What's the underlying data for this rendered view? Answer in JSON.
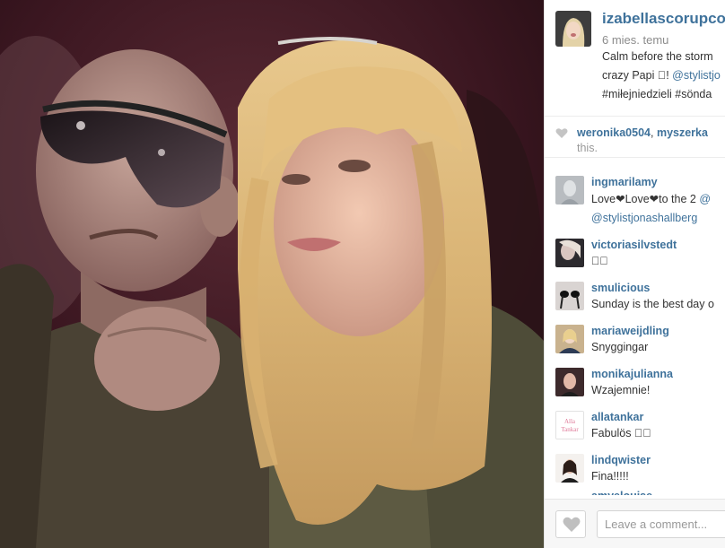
{
  "post": {
    "owner": "izabellascorupco",
    "time": "6 mies. temu",
    "caption_line1": "Calm before the storm",
    "caption_line2_text": "crazy Papi \u0000! ",
    "caption_line2_link": "@stylistjo",
    "caption_line3": "#miłejniedzieli #sönda"
  },
  "likes": {
    "user1": "weronika0504",
    "separator": ", ",
    "user2": "myszerka",
    "suffix": "this."
  },
  "comments": [
    {
      "user": "ingmarilamy",
      "text": "Love❤Love❤to the 2 ",
      "mention": "@",
      "text2": "@stylistjonashallberg"
    },
    {
      "user": "victoriasilvstedt",
      "text": "\u0000\u0000"
    },
    {
      "user": "smulicious",
      "text": "Sunday is the best day o"
    },
    {
      "user": "mariaweijdling",
      "text": "Snyggingar"
    },
    {
      "user": "monikajulianna",
      "text": "Wzajemnie!"
    },
    {
      "user": "allatankar",
      "text": "Fabulös \u0000\u0000",
      "avatar_text_1": "Alla",
      "avatar_text_2": "Tankar"
    },
    {
      "user": "lindqwister",
      "text": "Fina!!!!!"
    },
    {
      "user": "amyelouise",
      "text": ""
    }
  ],
  "footer": {
    "comment_placeholder": "Leave a comment..."
  },
  "icons": {
    "heart_small": "heart-outline-icon",
    "like_button": "heart-icon"
  },
  "colors": {
    "link": "#3f729b",
    "muted": "#8c8c8c",
    "text": "#333333"
  }
}
